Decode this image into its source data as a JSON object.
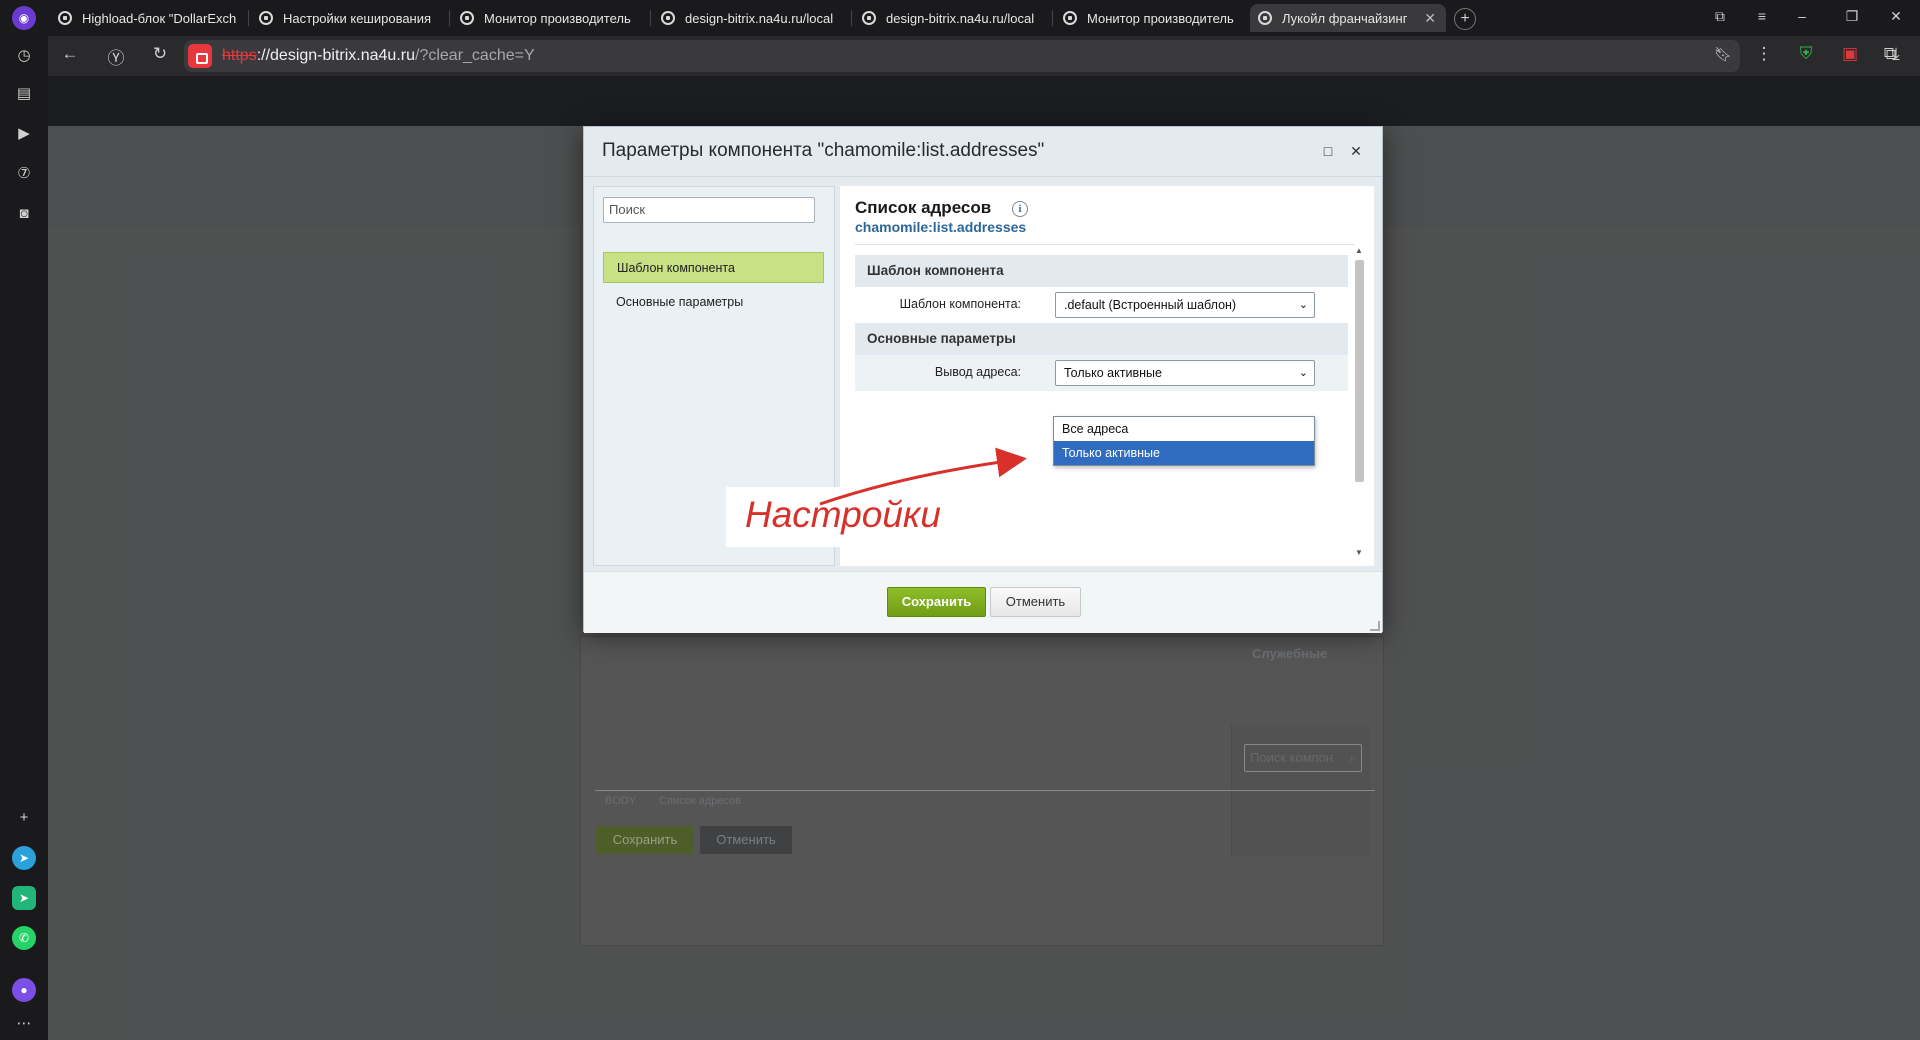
{
  "browser": {
    "tabs": [
      {
        "title": "Highload-блок \"DollarExch"
      },
      {
        "title": "Настройки кеширования"
      },
      {
        "title": "Монитор производитель"
      },
      {
        "title": "design-bitrix.na4u.ru/local"
      },
      {
        "title": "design-bitrix.na4u.ru/local"
      },
      {
        "title": "Монитор производитель"
      },
      {
        "title": "Лукойл франчайзинг",
        "active": true
      }
    ],
    "url": {
      "scheme": "https",
      "host": "://design-bitrix.na4u.ru",
      "path": "/?clear_cache=Y"
    }
  },
  "background": {
    "editor_status_body": "BODY",
    "editor_status_component": "Список адресов",
    "service_label": "Служебные",
    "component_search_placeholder": "Поиск компон",
    "save_label": "Сохранить",
    "cancel_label": "Отменить"
  },
  "dialog": {
    "title": "Параметры компонента \"chamomile:list.addresses\"",
    "search_placeholder": "Поиск",
    "nav": [
      {
        "label": "Шаблон компонента",
        "active": true
      },
      {
        "label": "Основные параметры",
        "active": false
      }
    ],
    "component_name": "Список адресов",
    "component_code": "chamomile:list.addresses",
    "sections": {
      "template": {
        "title": "Шаблон компонента",
        "field_label": "Шаблон компонента:",
        "value": ".default (Встроенный шаблон)"
      },
      "main": {
        "title": "Основные параметры",
        "field_label": "Вывод адреса:",
        "value": "Только активные",
        "options": [
          "Все адреса",
          "Только активные"
        ],
        "selected_option": "Только активные"
      }
    },
    "save_label": "Сохранить",
    "cancel_label": "Отменить"
  },
  "annotation": {
    "text": "Настройки",
    "color": "#d8302a"
  }
}
